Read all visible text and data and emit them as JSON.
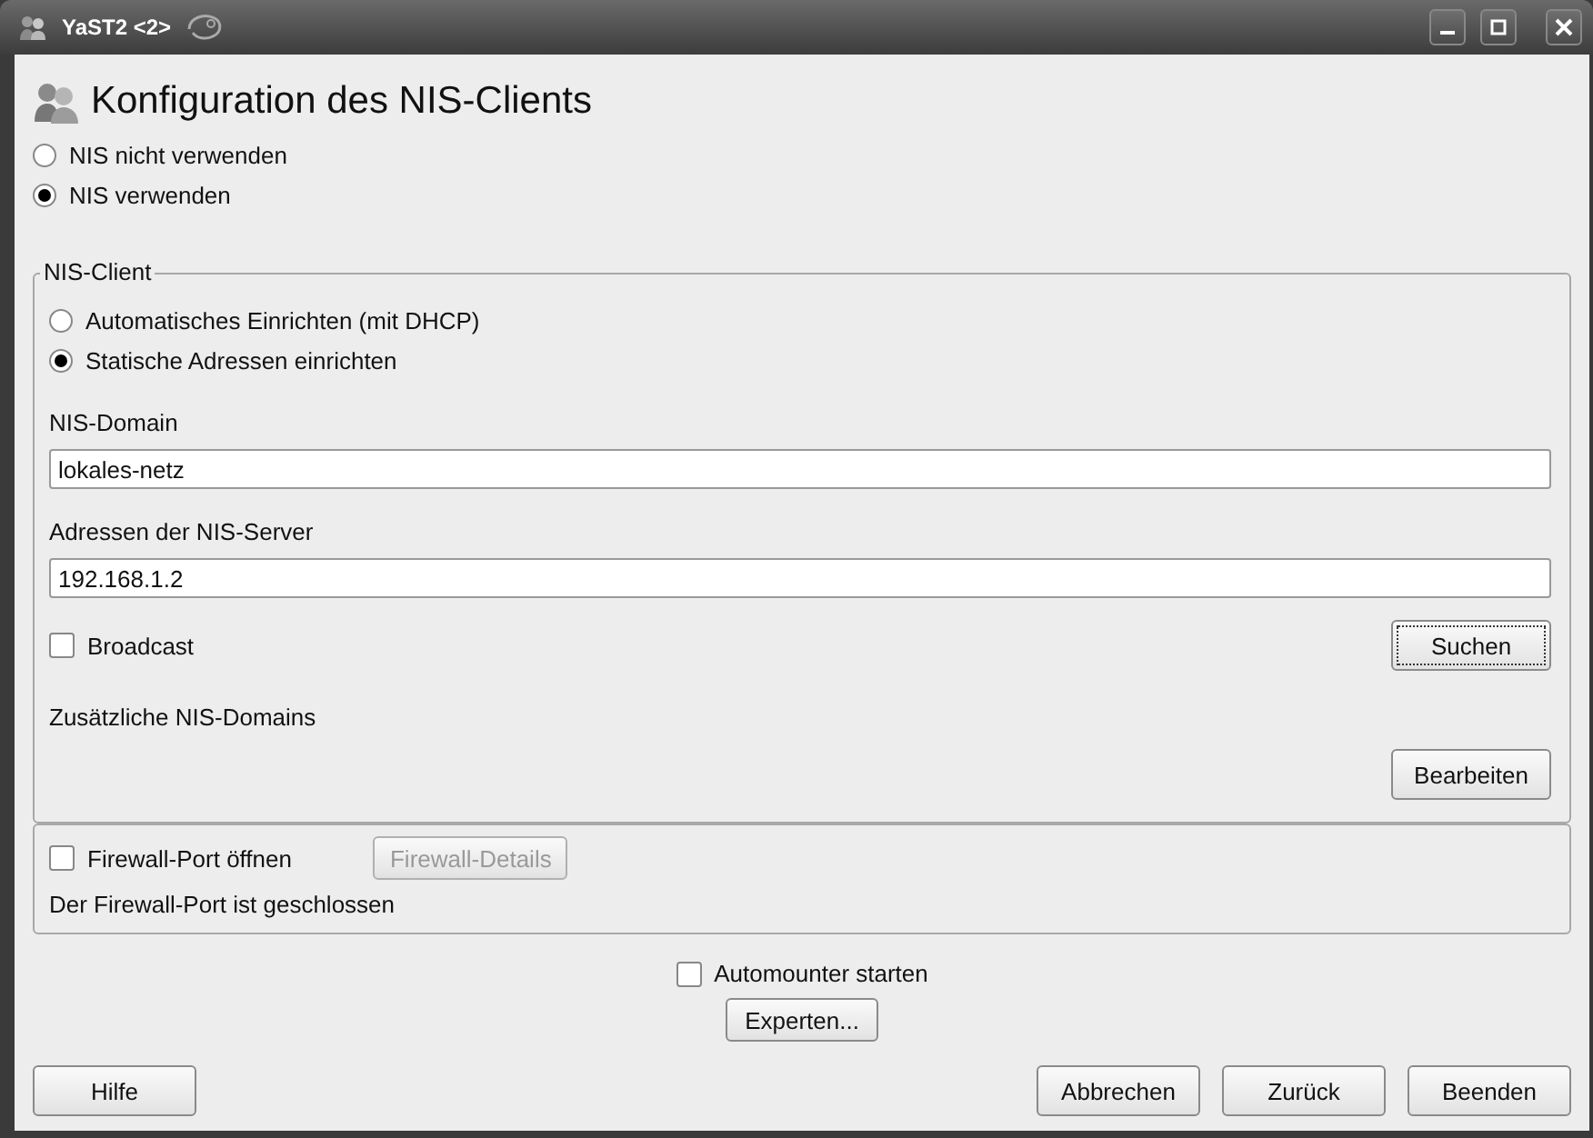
{
  "window": {
    "title": "YaST2 <2>"
  },
  "heading": "Konfiguration des NIS-Clients",
  "nis_mode": [
    {
      "label": "NIS nicht verwenden",
      "selected": false
    },
    {
      "label": "NIS verwenden",
      "selected": true
    }
  ],
  "nis_client": {
    "title": "NIS-Client",
    "setup": [
      {
        "label": "Automatisches Einrichten (mit DHCP)",
        "selected": false
      },
      {
        "label": "Statische Adressen einrichten",
        "selected": true
      }
    ],
    "domain": {
      "label": "NIS-Domain",
      "value": "lokales-netz"
    },
    "servers": {
      "label": "Adressen der NIS-Server",
      "value": "192.168.1.2"
    },
    "broadcast": {
      "label": "Broadcast",
      "checked": false
    },
    "search_button": {
      "label": "Suchen",
      "focused": true
    },
    "extra_domains": "Zusätzliche NIS-Domains",
    "edit_button": "Bearbeiten"
  },
  "firewall": {
    "open_port": {
      "label": "Firewall-Port öffnen",
      "checked": false
    },
    "details_button": {
      "label": "Firewall-Details",
      "disabled": true
    },
    "status": "Der Firewall-Port ist geschlossen"
  },
  "automounter": {
    "label": "Automounter starten",
    "checked": false
  },
  "expert_button": "Experten...",
  "help_button": "Hilfe",
  "action_buttons": [
    "Abbrechen",
    "Zurück",
    "Beenden"
  ]
}
